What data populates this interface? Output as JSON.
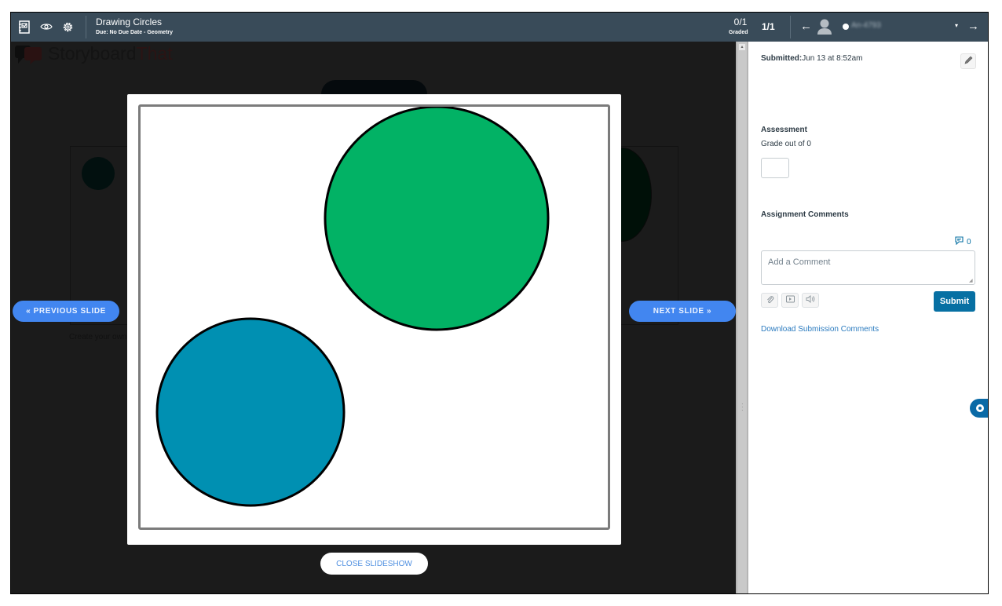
{
  "header": {
    "icons": [
      "gradebook-icon",
      "eye-icon",
      "settings-icon"
    ],
    "assignment_title": "Drawing Circles",
    "assignment_due": "Due: No Due Date - Geometry",
    "graded_count": "0/1",
    "graded_label": "Graded",
    "page_count": "1/1",
    "prev_student": "←",
    "next_student": "→",
    "student_name": "An-4793",
    "dropdown": "▾"
  },
  "background": {
    "logo_left": "Storyboard",
    "logo_right": "That",
    "caption": "Create your own"
  },
  "slideshow": {
    "prev_label": "« PREVIOUS SLIDE",
    "next_label": "NEXT SLIDE »",
    "close_label": "CLOSE SLIDESHOW",
    "shapes": [
      {
        "type": "circle",
        "fill": "#02b265",
        "stroke": "#000000"
      },
      {
        "type": "circle",
        "fill": "#0090b2",
        "stroke": "#000000"
      }
    ]
  },
  "side_panel": {
    "submitted_label": "Submitted:",
    "submitted_value": "Jun 13 at 8:52am",
    "assessment_title": "Assessment",
    "grade_label": "Grade out of 0",
    "grade_value": "",
    "comments_title": "Assignment Comments",
    "comment_count": "0",
    "comment_placeholder": "Add a Comment",
    "submit_label": "Submit",
    "download_label": "Download Submission Comments"
  },
  "colors": {
    "header_bg": "#394b59",
    "accent_blue": "#0770a3",
    "slide_nav_blue": "#4286f0"
  }
}
